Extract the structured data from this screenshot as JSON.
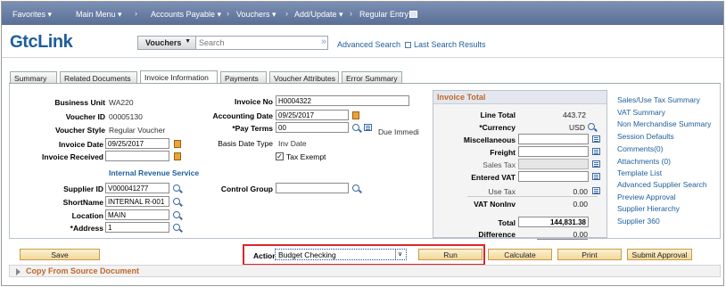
{
  "nav": {
    "favorites": "Favorites",
    "main_menu": "Main Menu",
    "accounts_payable": "Accounts Payable",
    "vouchers": "Vouchers",
    "add_update": "Add/Update",
    "regular_entry": "Regular Entry"
  },
  "header": {
    "logo_prefix": "c",
    "logo_mid": "tc",
    "logo_suffix": "Link",
    "search_scope": "Vouchers",
    "search_placeholder": "Search",
    "advanced_search": "Advanced Search",
    "last_search_results": "Last Search Results"
  },
  "tabs": [
    "Summary",
    "Related Documents",
    "Invoice Information",
    "Payments",
    "Voucher Attributes",
    "Error Summary"
  ],
  "left": {
    "business_unit_label": "Business Unit",
    "business_unit": "WA220",
    "voucher_id_label": "Voucher ID",
    "voucher_id": "00005130",
    "voucher_style_label": "Voucher Style",
    "voucher_style": "Regular Voucher",
    "invoice_date_label": "Invoice Date",
    "invoice_date": "09/25/2017",
    "invoice_received_label": "Invoice Received",
    "invoice_received": "",
    "supplier_name_link": "Internal Revenue Service",
    "supplier_id_label": "Supplier ID",
    "supplier_id": "V000041277",
    "shortname_label": "ShortName",
    "shortname": "INTERNAL R-001",
    "location_label": "Location",
    "location": "MAIN",
    "address_label": "*Address",
    "address": "1"
  },
  "mid": {
    "invoice_no_label": "Invoice No",
    "invoice_no": "H0004322",
    "accounting_date_label": "Accounting Date",
    "accounting_date": "09/25/2017",
    "pay_terms_label": "*Pay Terms",
    "pay_terms": "00",
    "due_immed": "Due Immedi",
    "basis_date_type_label": "Basis Date Type",
    "basis_date_type": "Inv Date",
    "tax_exempt_label": "Tax Exempt",
    "tax_exempt_check": "✓",
    "control_group_label": "Control Group",
    "control_group": ""
  },
  "invoice_total": {
    "title": "Invoice Total",
    "line_total_label": "Line Total",
    "line_total": "443.72",
    "currency_label": "*Currency",
    "currency": "USD",
    "misc_label": "Miscellaneous",
    "freight_label": "Freight",
    "sales_tax_label": "Sales Tax",
    "entered_vat_label": "Entered VAT",
    "use_tax_label": "Use Tax",
    "use_tax": "0.00",
    "vat_noninv_label": "VAT NonInv",
    "vat_noninv": "0.00",
    "total_label": "Total",
    "total": "144,831.38",
    "difference_label": "Difference",
    "difference": "0.00"
  },
  "links": [
    "Sales/Use Tax Summary",
    "VAT Summary",
    "Non Merchandise Summary",
    "Session Defaults",
    "Comments(0)",
    "Attachments (0)",
    "Template List",
    "Advanced Supplier Search",
    "Preview Approval",
    "Supplier Hierarchy",
    "Supplier 360"
  ],
  "actions": {
    "save": "Save",
    "action_label": "Action:",
    "action_value": "Budget Checking",
    "run": "Run",
    "calculate": "Calculate",
    "print": "Print",
    "submit_approval": "Submit Approval"
  },
  "copy_from": "Copy From Source Document",
  "colors": {
    "nav_bar": "#6b80a6",
    "accent_orange": "#c0672a",
    "link_blue": "#1d5e9c",
    "highlight_red": "#d9262c",
    "button_fill": "#f6e1ad"
  }
}
